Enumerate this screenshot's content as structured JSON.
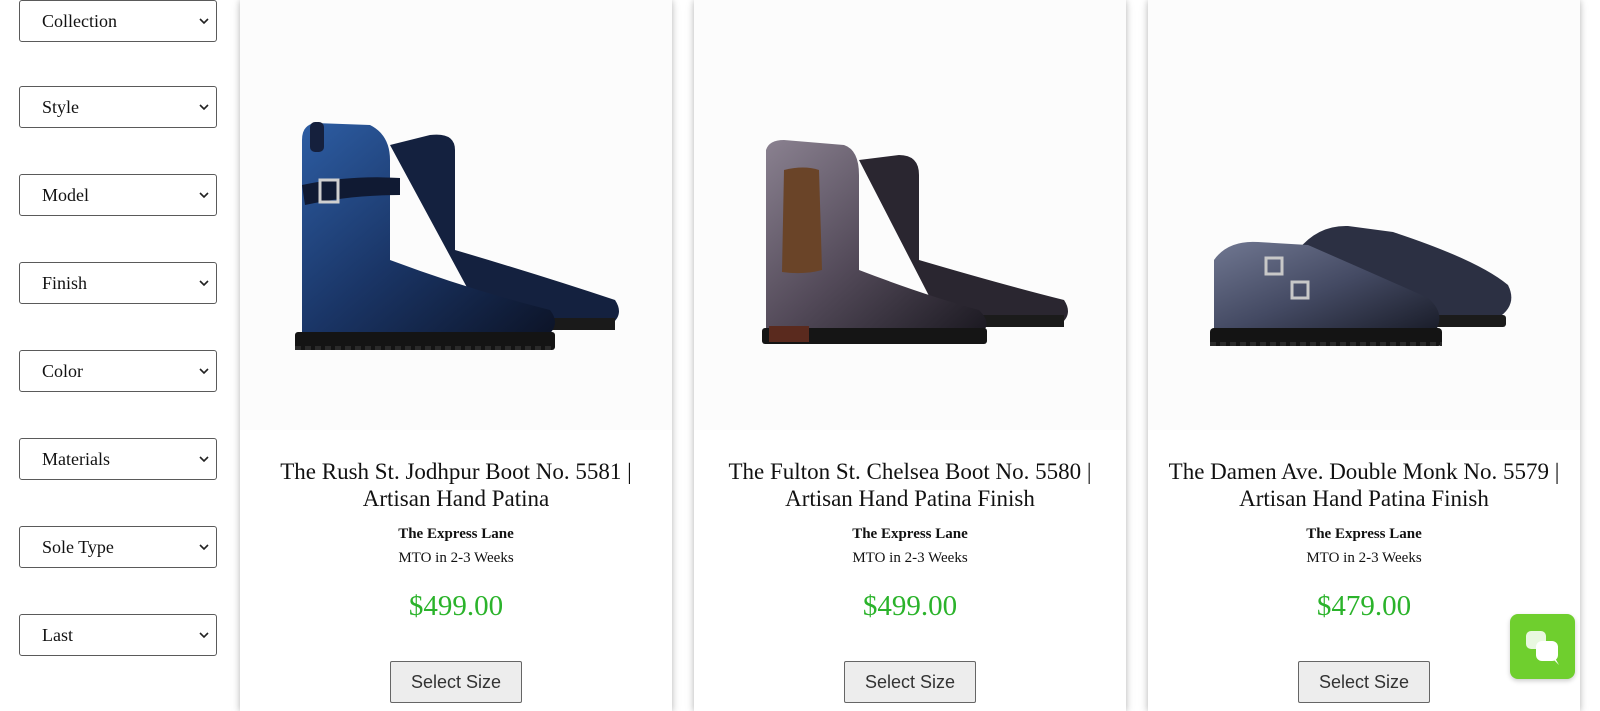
{
  "filters": [
    {
      "label": "Collection",
      "icon": "chevron-down-icon"
    },
    {
      "label": "Style",
      "icon": "chevron-down-icon"
    },
    {
      "label": "Model",
      "icon": "chevron-down-icon"
    },
    {
      "label": "Finish",
      "icon": "chevron-down-icon"
    },
    {
      "label": "Color",
      "icon": "chevron-down-icon"
    },
    {
      "label": "Materials",
      "icon": "chevron-down-icon"
    },
    {
      "label": "Sole Type",
      "icon": "chevron-down-icon"
    },
    {
      "label": "Last",
      "icon": "chevron-down-icon"
    }
  ],
  "products": [
    {
      "title_line1": "The Rush St. Jodhpur Boot No. 5581 |",
      "title_line2": "Artisan Hand Patina",
      "vendor": "The Express Lane",
      "lead_time": "MTO in 2-3 Weeks",
      "price": "$499.00",
      "button": "Select Size",
      "image": "jodhpur-boot-image",
      "color": "#1f3a6e"
    },
    {
      "title_line1": "The Fulton St. Chelsea Boot No. 5580 |",
      "title_line2": "Artisan Hand Patina Finish",
      "vendor": "The Express Lane",
      "lead_time": "MTO in 2-3 Weeks",
      "price": "$499.00",
      "button": "Select Size",
      "image": "chelsea-boot-image",
      "color": "#4a4350"
    },
    {
      "title_line1": "The Damen Ave. Double Monk No. 5579 |",
      "title_line2": "Artisan Hand Patina Finish",
      "vendor": "The Express Lane",
      "lead_time": "MTO in 2-3 Weeks",
      "price": "$479.00",
      "button": "Select Size",
      "image": "double-monk-shoe-image",
      "color": "#3b3f55"
    }
  ],
  "chat_widget": {
    "icon": "chat-bubbles-icon",
    "color": "#6fcf2e"
  },
  "theme": {
    "price_color": "#2bb32b",
    "button_bg": "#ededed"
  }
}
